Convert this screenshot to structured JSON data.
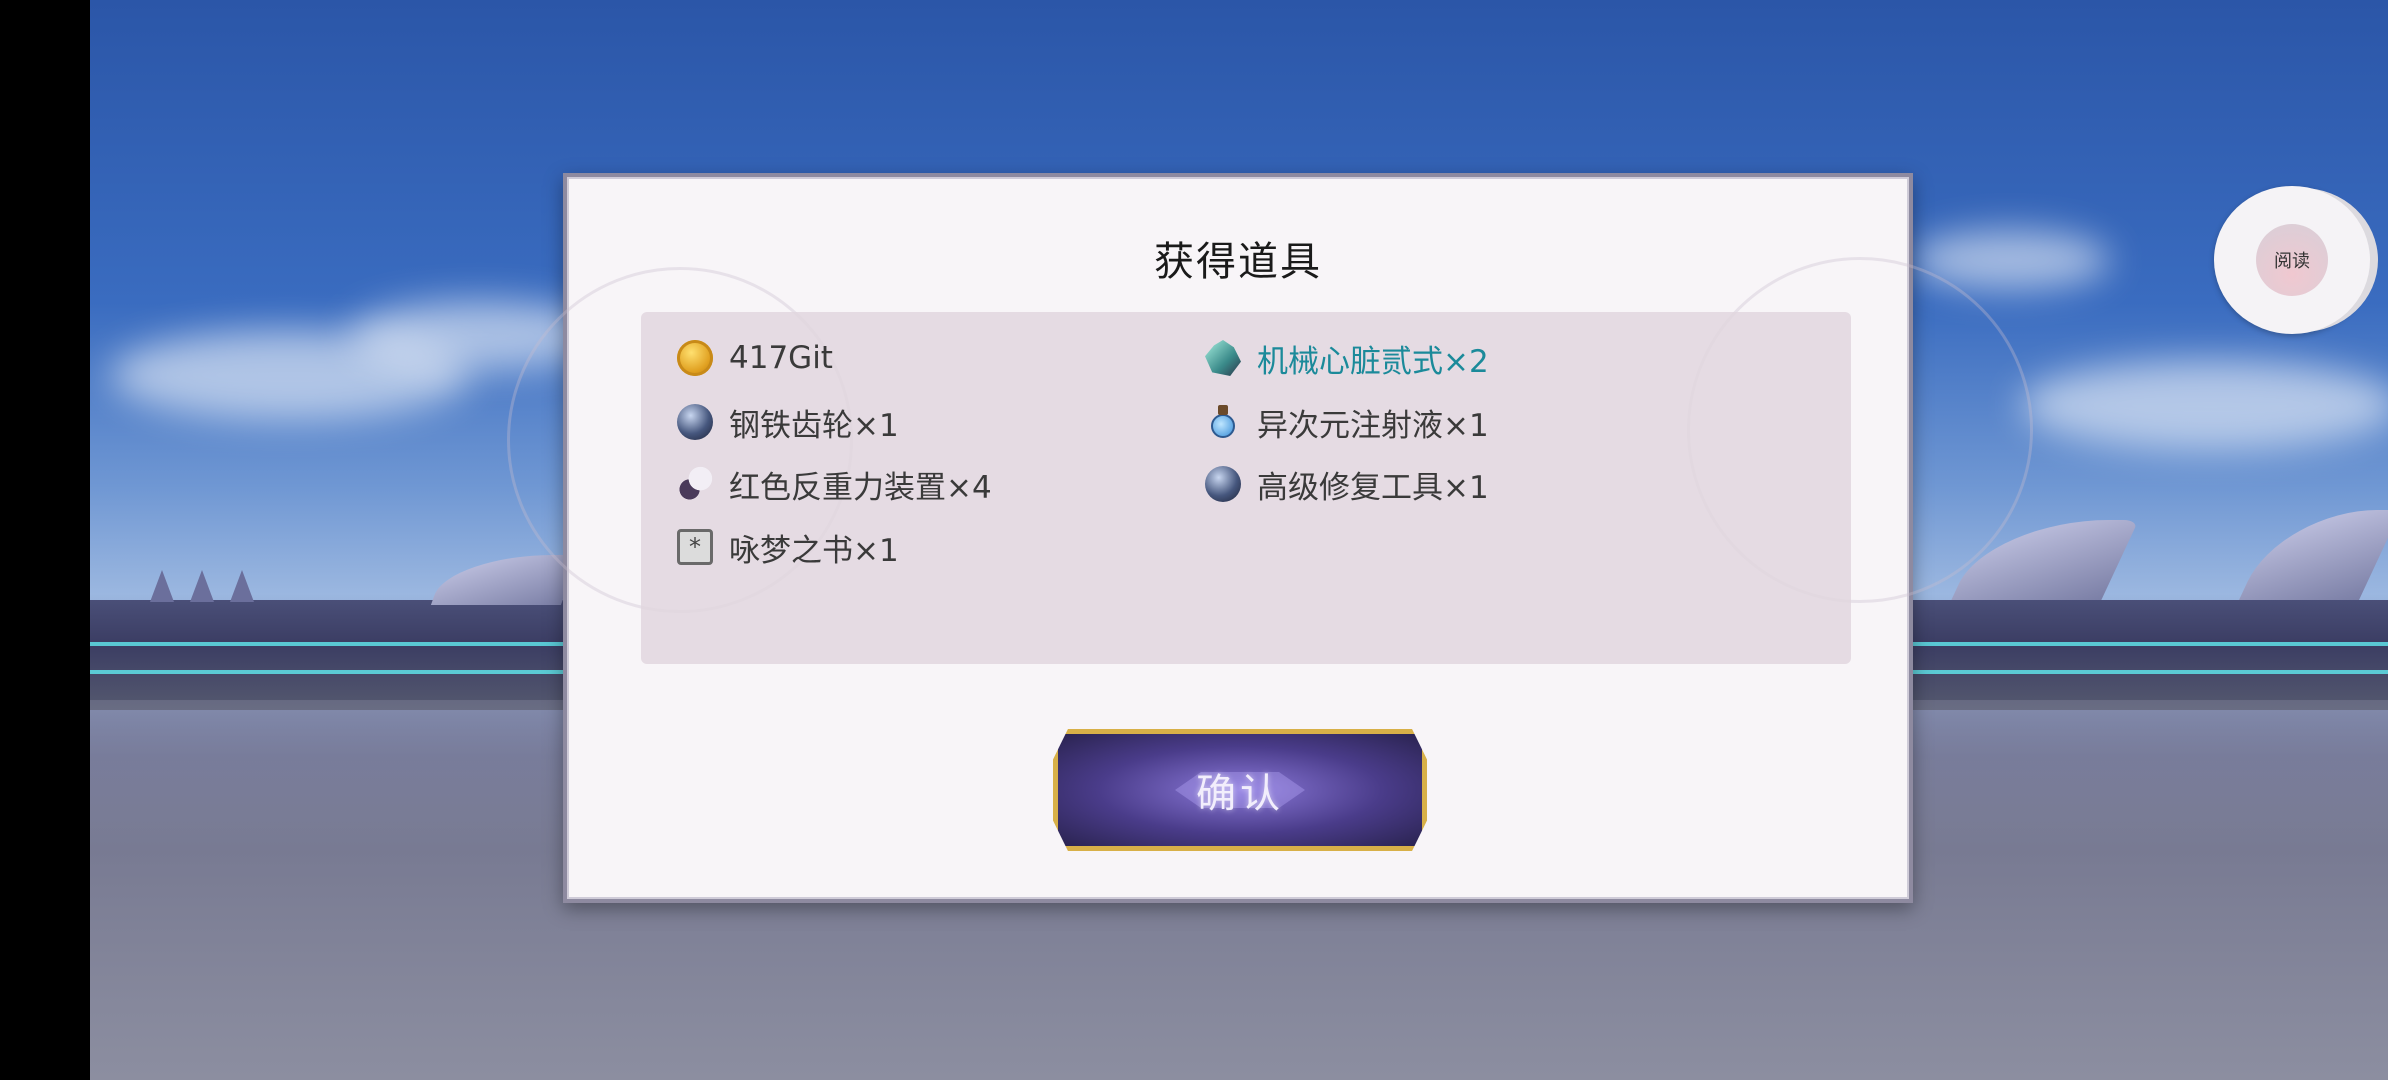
{
  "dialog": {
    "title": "获得道具",
    "items": [
      {
        "icon": "coin-icon",
        "label": "417Git"
      },
      {
        "icon": "mechanical-heart-icon",
        "label": "机械心脏贰式×2"
      },
      {
        "icon": "orb-icon",
        "label": "钢铁齿轮×1"
      },
      {
        "icon": "flask-icon",
        "label": "异次元注射液×1"
      },
      {
        "icon": "gadget-icon",
        "label": "红色反重力装置×4"
      },
      {
        "icon": "orb-icon",
        "label": "高级修复工具×1"
      },
      {
        "icon": "book-icon",
        "label": "咏梦之书×1"
      }
    ],
    "confirm_label": "确认"
  },
  "floating": {
    "label": "阅读"
  },
  "colors": {
    "highlight_item": "#1b8a9a",
    "button_border": "#d8b048",
    "button_fill": "#4a3c8a"
  }
}
